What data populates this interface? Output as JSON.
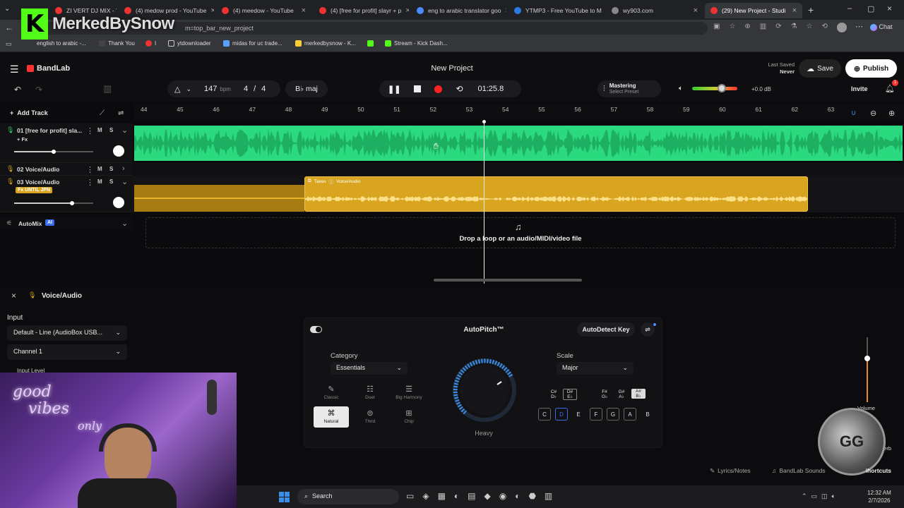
{
  "browser": {
    "tabs": [
      {
        "title": "ZI VERT DJ MIX - Yo",
        "color": "#e33"
      },
      {
        "title": "(4) medow prod - YouTube",
        "color": "#e33"
      },
      {
        "title": "(4) meedow - YouTube",
        "color": "#e33"
      },
      {
        "title": "(4) [free for profit] slayr + p",
        "color": "#e33"
      },
      {
        "title": "eng to arabic translator goo",
        "color": "#4a8cff"
      },
      {
        "title": "YTMP3 - Free YouTube to M",
        "color": "#2a7be0"
      },
      {
        "title": "wy903.com",
        "color": "#888"
      },
      {
        "title": "(29) New Project - Studi",
        "color": "#e33"
      }
    ],
    "url": "m=top_bar_new_project",
    "chat_label": "Chat",
    "bookmarks": [
      "english to arabic -...",
      "Thank You",
      "I",
      "ytdownloader",
      "midas for uc trade...",
      "merkedbysnow - K...",
      "Stream - Kick Dash..."
    ],
    "overlay_logo_text": "MerkedBySnow"
  },
  "app": {
    "brand": "BandLab",
    "project_title": "New Project",
    "bpm": "147",
    "bpm_unit": "bpm",
    "time_sig_num": "4",
    "time_sig_den": "4",
    "key": "B♭ maj",
    "time": "01:25.8",
    "mastering": "Mastering",
    "select_preset": "Select Preset",
    "db": "+0.0 dB",
    "last_saved_label": "Last Saved",
    "last_saved_value": "Never",
    "save": "Save",
    "publish": "Publish",
    "invite": "Invite",
    "notif_count": "1",
    "add_track": "Add Track",
    "volume_level": 0.78
  },
  "ruler": [
    "44",
    "45",
    "46",
    "47",
    "48",
    "49",
    "50",
    "51",
    "52",
    "53",
    "54",
    "55",
    "56",
    "57",
    "58",
    "59",
    "60",
    "61",
    "62",
    "63"
  ],
  "tracks": [
    {
      "num": "01",
      "name": "[free for profit] sla...",
      "fx": "+ Fx"
    },
    {
      "num": "02",
      "name": "Voice/Audio"
    },
    {
      "num": "03",
      "name": "Voice/Audio",
      "fx": "Fx UNTIL JPN"
    }
  ],
  "clip": {
    "takes": "Takes",
    "name": "Voice/Audio"
  },
  "automix": "AutoMix",
  "ai_badge": "AI",
  "dropzone": "Drop a loop or an audio/MIDI/video file",
  "panel": {
    "title": "Voice/Audio",
    "input_label": "Input",
    "input_device": "Default - Line (AudioBox USB...",
    "channel": "Channel 1",
    "input_level": "Input Level"
  },
  "autopitch": {
    "title": "AutoPitch™",
    "autodetect": "AutoDetect Key",
    "category_label": "Category",
    "category_value": "Essentials",
    "scale_label": "Scale",
    "scale_value": "Major",
    "strength_label": "Heavy",
    "presets": [
      "Classic",
      "Duet",
      "Big Harmony",
      "Natural",
      "Third",
      "Chip"
    ],
    "sharps": [
      "C#\nD♭",
      "D#\nE♭",
      "F#\nG♭",
      "G#\nA♭",
      "A#\nB♭"
    ],
    "naturals": [
      "C",
      "D",
      "E",
      "F",
      "G",
      "A",
      "B"
    ]
  },
  "footer": {
    "lyrics": "Lyrics/Notes",
    "sounds": "BandLab Sounds",
    "shortcuts": "Shortcuts",
    "volume": "Volume",
    "reverb": "Reverb"
  },
  "webcam": {
    "sign_line1": "good",
    "sign_line2": "vibes",
    "sign_line3": "only"
  },
  "taskbar": {
    "search": "Search",
    "time": "12:32 AM",
    "date": "2/7/2026"
  }
}
